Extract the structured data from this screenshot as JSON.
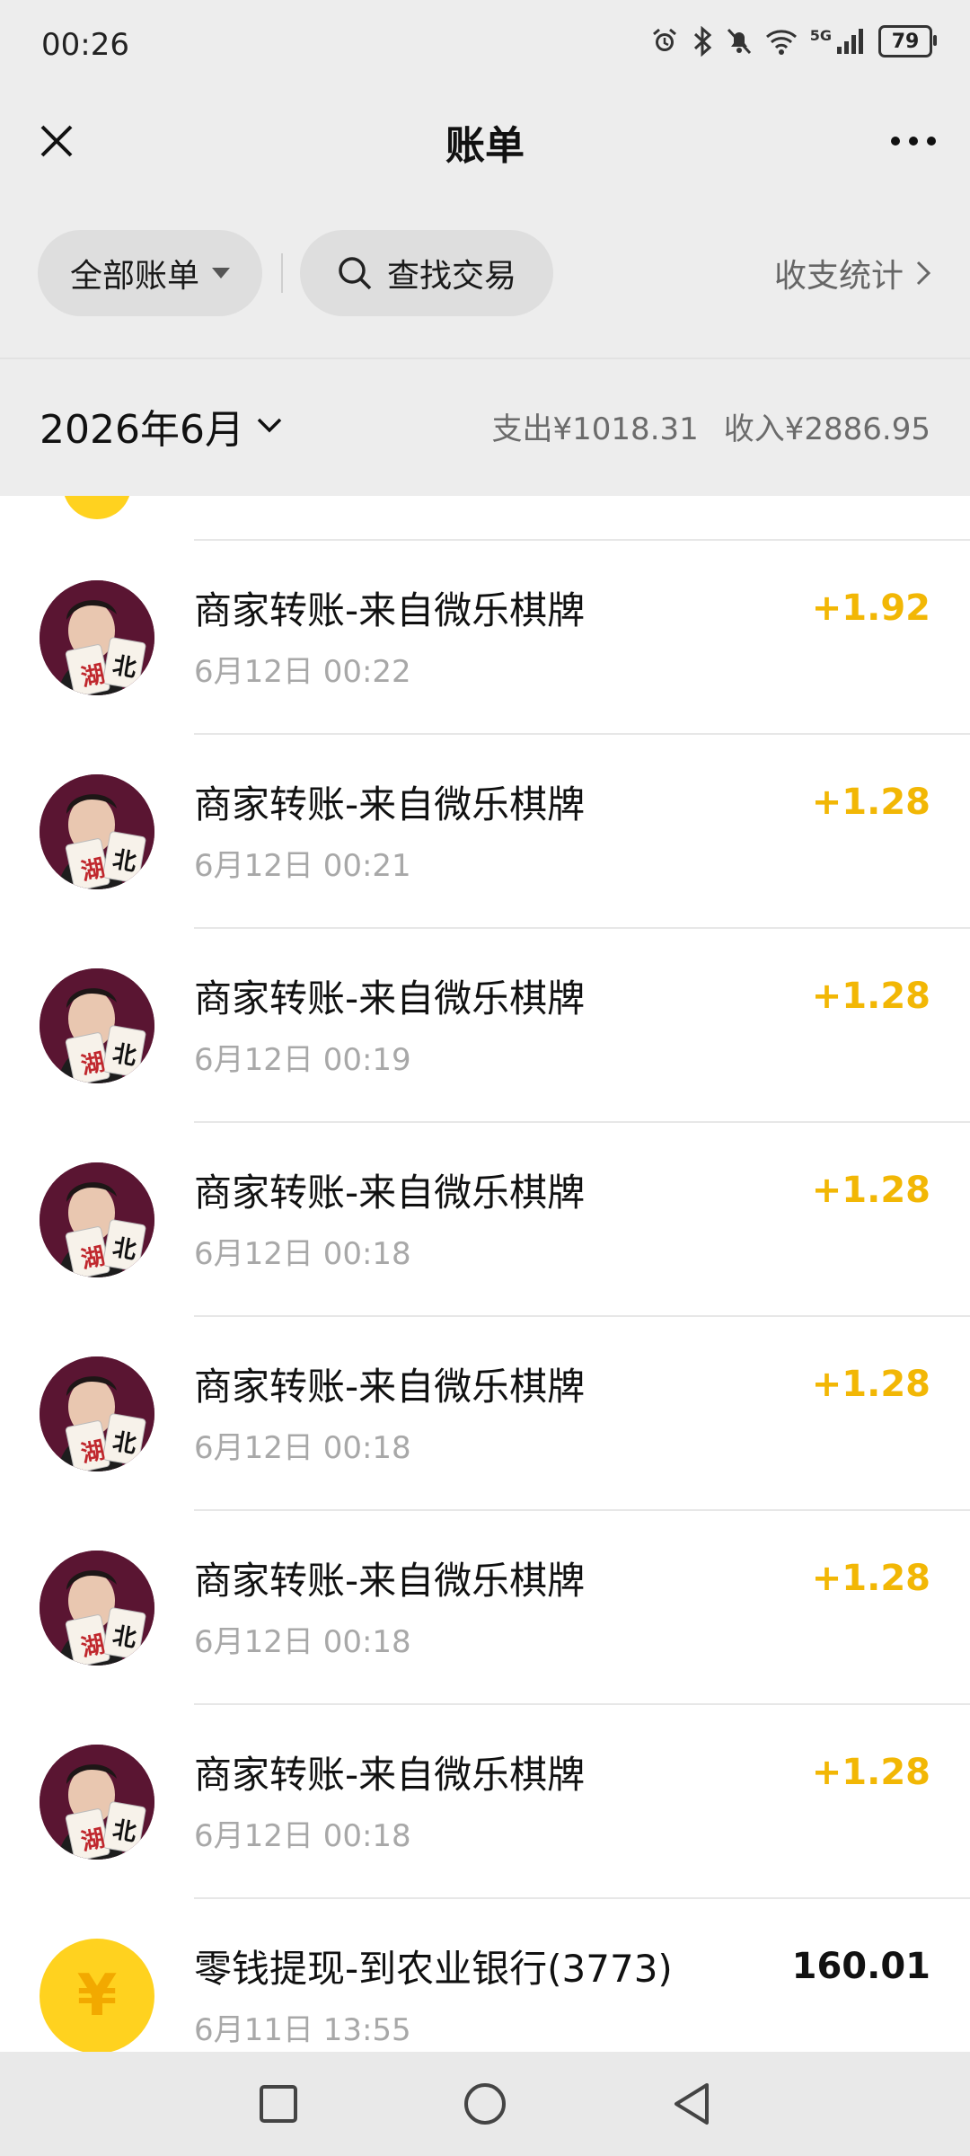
{
  "status_bar": {
    "time": "00:26",
    "network": "5G",
    "battery": "79"
  },
  "header": {
    "title": "账单"
  },
  "filters": {
    "all_bills": "全部账单",
    "search": "查找交易",
    "stats": "收支统计"
  },
  "month": {
    "label": "2026年6月",
    "expense": "支出¥1018.31",
    "income": "收入¥2886.95"
  },
  "transactions": [
    {
      "title": "商家转账-来自微乐棋牌",
      "time": "6月12日 00:22",
      "amount": "+1.92",
      "type": "income"
    },
    {
      "title": "商家转账-来自微乐棋牌",
      "time": "6月12日 00:21",
      "amount": "+1.28",
      "type": "income"
    },
    {
      "title": "商家转账-来自微乐棋牌",
      "time": "6月12日 00:19",
      "amount": "+1.28",
      "type": "income"
    },
    {
      "title": "商家转账-来自微乐棋牌",
      "time": "6月12日 00:18",
      "amount": "+1.28",
      "type": "income"
    },
    {
      "title": "商家转账-来自微乐棋牌",
      "time": "6月12日 00:18",
      "amount": "+1.28",
      "type": "income"
    },
    {
      "title": "商家转账-来自微乐棋牌",
      "time": "6月12日 00:18",
      "amount": "+1.28",
      "type": "income"
    },
    {
      "title": "商家转账-来自微乐棋牌",
      "time": "6月12日 00:18",
      "amount": "+1.28",
      "type": "income"
    },
    {
      "title": "零钱提现-到农业银行(3773)",
      "time": "6月11日 13:55",
      "amount": "160.01",
      "type": "expense"
    }
  ],
  "avatar_card_text": [
    "湖",
    "北"
  ],
  "yen_symbol": "¥",
  "colors": {
    "income": "#f2b705",
    "coin": "#ffd21f",
    "background": "#ededed"
  }
}
